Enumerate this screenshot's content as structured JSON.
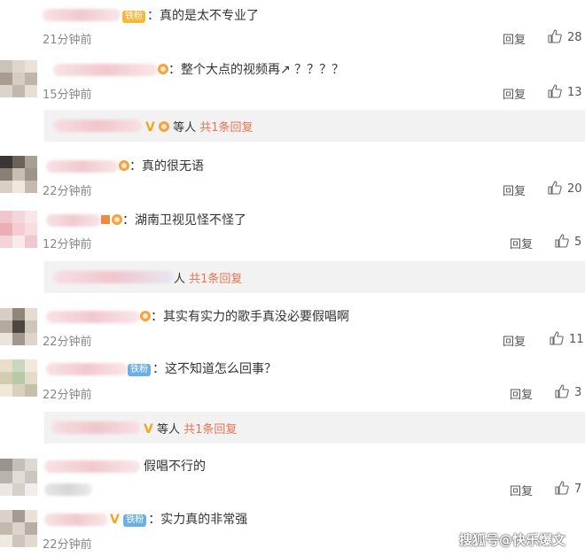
{
  "comments": [
    {
      "badge": "铁粉",
      "text": "：真的是太不专业了",
      "time": "21分钟前",
      "reply": "回复",
      "likes": "28"
    },
    {
      "text": "：整个大点的视频再",
      "suffix": "↗ ？？？？",
      "time": "15分钟前",
      "reply": "回复",
      "likes": "13"
    },
    {
      "text": "：真的很无语",
      "time": "22分钟前",
      "reply": "回复",
      "likes": "20"
    },
    {
      "text": "：湖南卫视见怪不怪了",
      "time": "12分钟前",
      "reply": "回复",
      "likes": "5"
    },
    {
      "text": "：其实有实力的歌手真没必要假唱啊",
      "time": "22分钟前",
      "reply": "回复",
      "likes": "11"
    },
    {
      "badge": "铁粉",
      "text": "：这不知道怎么回事？",
      "time": "22分钟前",
      "reply": "回复",
      "likes": "3"
    },
    {
      "text": "假唱不行的",
      "time": "",
      "reply": "回复",
      "likes": "7"
    },
    {
      "badge": "铁粉",
      "text": "：实力真的非常强",
      "time": "22分钟前"
    }
  ],
  "subreplies": [
    {
      "prefix": "等人",
      "link": "共1条回复"
    },
    {
      "prefix": "人",
      "link": "共1条回复"
    },
    {
      "prefix": "等人",
      "link": "共1条回复"
    }
  ],
  "watermark": "搜狐号@快乐爆文",
  "colors": {
    "link": "#eb7350",
    "badge_gold": "#f5b83c",
    "badge_blue": "#6ab0e6",
    "subbar_bg": "#f2f2f2"
  }
}
